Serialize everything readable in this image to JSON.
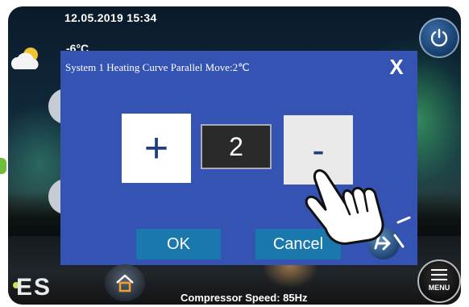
{
  "status_bar": {
    "datetime": "12.05.2019  15:34"
  },
  "weather": {
    "icon": "partly-cloudy-icon",
    "temperature": "-6°C"
  },
  "dialog": {
    "title": "System 1 Heating Curve Parallel Move:2℃",
    "close_label": "X",
    "increment_label": "+",
    "value": "2",
    "decrement_label": "-",
    "ok_label": "OK",
    "cancel_label": "Cancel"
  },
  "footer": {
    "brand": "ES",
    "compressor_status": "Compressor Speed: 85Hz",
    "menu_label": "MENU"
  },
  "colors": {
    "dialog_bg": "#3553b3",
    "button_bg": "#1a78ad",
    "display_bg": "#2a2a2a"
  }
}
